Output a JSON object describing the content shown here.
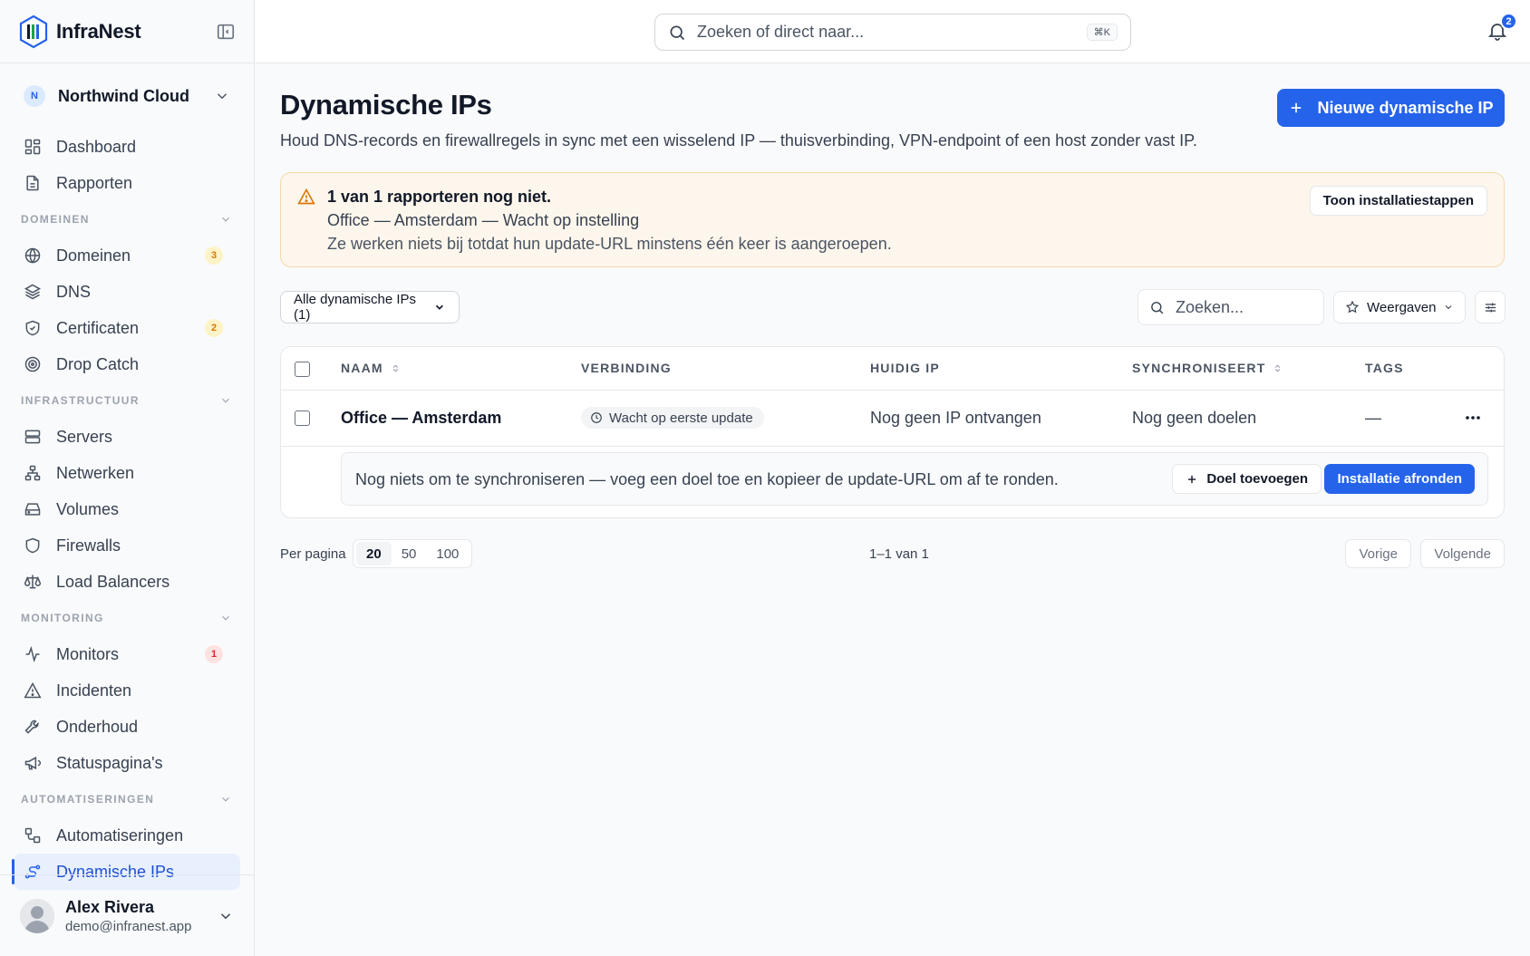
{
  "app": {
    "name": "InfraNest"
  },
  "org": {
    "initial": "N",
    "name": "Northwind Cloud"
  },
  "nav": {
    "dashboard": "Dashboard",
    "rapporten": "Rapporten",
    "sections": {
      "domeinen": "DOMEINEN",
      "infrastructuur": "INFRASTRUCTUUR",
      "monitoring": "MONITORING",
      "automatiseringen": "AUTOMATISERINGEN"
    },
    "items": {
      "domeinen": {
        "label": "Domeinen",
        "count": "3"
      },
      "dns": {
        "label": "DNS"
      },
      "certificaten": {
        "label": "Certificaten",
        "count": "2"
      },
      "dropcatch": {
        "label": "Drop Catch"
      },
      "servers": {
        "label": "Servers"
      },
      "netwerken": {
        "label": "Netwerken"
      },
      "volumes": {
        "label": "Volumes"
      },
      "firewalls": {
        "label": "Firewalls"
      },
      "loadbalancers": {
        "label": "Load Balancers"
      },
      "monitors": {
        "label": "Monitors",
        "count": "1"
      },
      "incidenten": {
        "label": "Incidenten"
      },
      "onderhoud": {
        "label": "Onderhoud"
      },
      "statuspaginas": {
        "label": "Statuspagina's"
      },
      "automatiseringen": {
        "label": "Automatiseringen"
      },
      "dynamischeips": {
        "label": "Dynamische IPs"
      }
    }
  },
  "user": {
    "name": "Alex Rivera",
    "email": "demo@infranest.app"
  },
  "topbar": {
    "search_placeholder": "Zoeken of direct naar...",
    "shortcut": "⌘K",
    "notifications": "2"
  },
  "page": {
    "title": "Dynamische IPs",
    "subtitle": "Houd DNS-records en firewallregels in sync met een wisselend IP — thuisverbinding, VPN-endpoint of een host zonder vast IP.",
    "new_button": "Nieuwe dynamische IP"
  },
  "alert": {
    "line1": "1 van 1 rapporteren nog niet.",
    "line2": "Office — Amsterdam — Wacht op instelling",
    "line3": "Ze werken niets bij totdat hun update-URL minstens één keer is aangeroepen.",
    "button": "Toon installatiestappen"
  },
  "toolbar": {
    "filter": "Alle dynamische IPs (1)",
    "search_placeholder": "Zoeken...",
    "views": "Weergaven"
  },
  "table": {
    "columns": [
      "NAAM",
      "VERBINDING",
      "HUIDIG IP",
      "SYNCHRONISEERT",
      "TAGS"
    ],
    "rows": [
      {
        "name": "Office — Amsterdam",
        "connection": "Wacht op eerste update",
        "current_ip": "Nog geen IP ontvangen",
        "syncs": "Nog geen doelen",
        "tags": "—"
      }
    ],
    "expand": {
      "text": "Nog niets om te synchroniseren — voeg een doel toe en kopieer de update-URL om af te ronden.",
      "add_target": "Doel toevoegen",
      "finish": "Installatie afronden"
    }
  },
  "pagination": {
    "per_page_label": "Per pagina",
    "options": [
      "20",
      "50",
      "100"
    ],
    "selected": "20",
    "range": "1–1 van 1",
    "prev": "Vorige",
    "next": "Volgende"
  }
}
